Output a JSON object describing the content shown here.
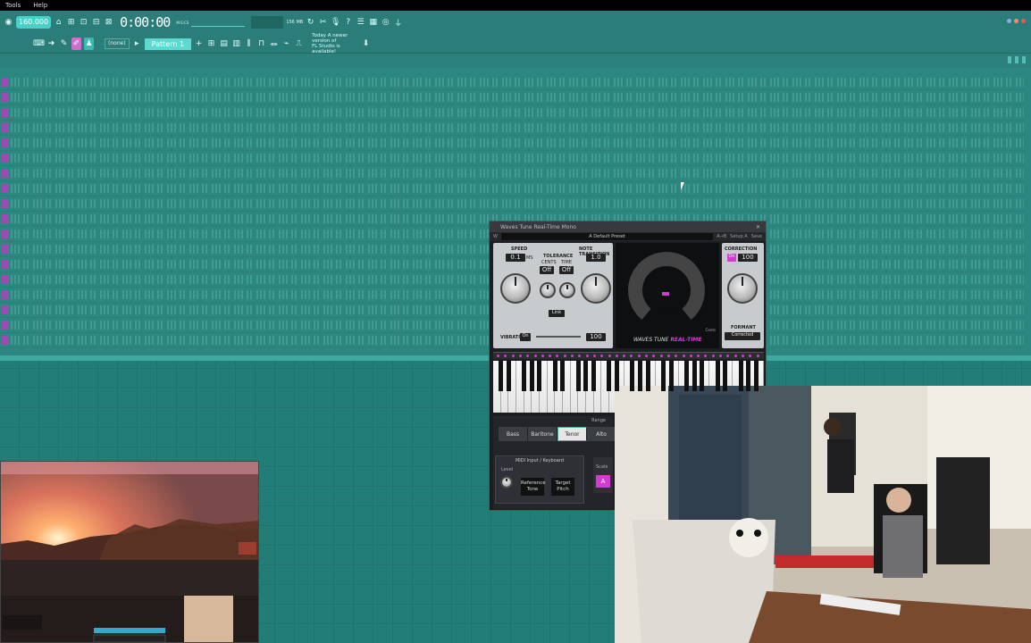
{
  "menu": [
    "Tools",
    "Help"
  ],
  "toolbar": {
    "tempo": "160.000",
    "time": "0:00:00",
    "time_caption": "M:S:CS",
    "memory": "156 MB",
    "pattern": "Pattern 1",
    "snap": "(none)",
    "news_line1": "Today  A newer version of",
    "news_line2": "FL Studio is available!"
  },
  "playlist": {
    "rows": 18
  },
  "plugin": {
    "title": "Waves Tune Real-Time Mono",
    "preset": "A Default Preset",
    "compare": "A→B",
    "setup": "Setup A",
    "save": "Save",
    "speed_label": "Speed",
    "speed_value": "0.1",
    "speed_unit": "ms",
    "tolerance_label": "Tolerance",
    "cents_label": "Cents",
    "time_label": "Time",
    "tol_cents": "Off",
    "tol_time": "Off",
    "note_transition_label": "Note Transition",
    "note_transition_value": "1.0",
    "link_label": "Link",
    "vibrato_label": "Vibrato",
    "vibrato_state": "On",
    "vibrato_value": "100",
    "correction_label": "Correction",
    "correction_state": "On",
    "correction_value": "100",
    "formant_label": "Formant",
    "formant_state": "Corrected",
    "brand": "WAVES TUNE",
    "brand_accent": "REAL-TIME",
    "cents_caption": "Cents",
    "range_label": "Range",
    "voices": [
      "Bass",
      "Baritone",
      "Tenor",
      "Alto"
    ],
    "selected_voice": "Tenor",
    "midi_label": "MIDI Input / Keyboard",
    "level_label": "Level",
    "ref_tone": "Reference Tone",
    "target_pitch": "Target Pitch",
    "scale_label": "Scale",
    "scale_key": "A"
  },
  "colors": {
    "accent": "#d43bd0",
    "fl_teal": "#2a7d78"
  }
}
